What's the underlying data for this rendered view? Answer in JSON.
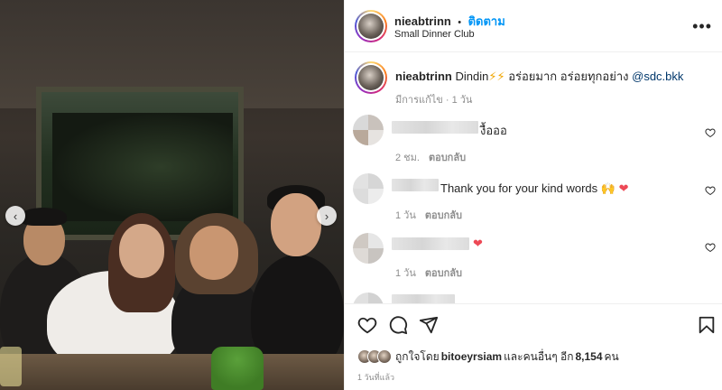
{
  "post": {
    "username": "nieabtrinn",
    "follow_label": "ติดตาม",
    "separator": "•",
    "location": "Small Dinner Club",
    "more_label": "•••"
  },
  "caption": {
    "username": "nieabtrinn",
    "text_before": "Dindin",
    "emoji": "⚡⚡",
    "text_after": " อร่อยมาก อร่อยทุกอย่าง ",
    "mention": "@sdc.bkk",
    "meta": "มีการแก้ไข · 1 วัน"
  },
  "comments": [
    {
      "text": "งื้อออ",
      "time": "2 ชม.",
      "reply_label": "ตอบกลับ"
    },
    {
      "text": "Thank you for your kind words 🙌",
      "heart": "❤",
      "time": "1 วัน",
      "reply_label": "ตอบกลับ"
    },
    {
      "text": "",
      "heart": "❤",
      "time": "1 วัน",
      "reply_label": "ตอบกลับ"
    }
  ],
  "likes": {
    "prefix": "ถูกใจโดย ",
    "user": "bitoeyrsiam",
    "suffix": " และคนอื่นๆ อีก ",
    "count": "8,154",
    "unit": " คน"
  },
  "date": "1 วันที่แล้ว",
  "photo": {
    "prev_label": "‹",
    "next_label": "›"
  },
  "colors": {
    "accent": "#0095f6",
    "heart": "#ed4956",
    "text": "#262626",
    "muted": "#8e8e8e"
  }
}
